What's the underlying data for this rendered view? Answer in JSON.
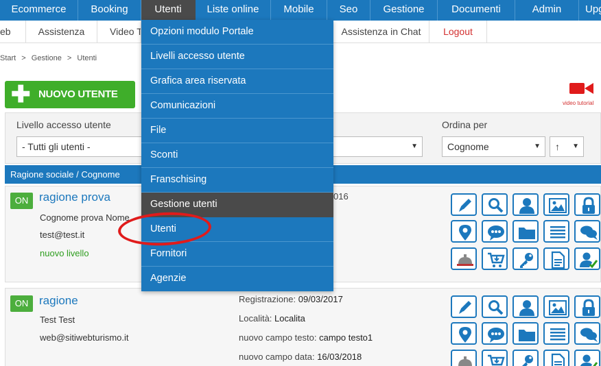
{
  "topnav": [
    "Ecommerce",
    "Booking",
    "Utenti",
    "Liste online",
    "Mobile",
    "Seo",
    "Gestione",
    "Documenti",
    "Admin",
    "Upg"
  ],
  "subnav": [
    "eb",
    "Assistenza",
    "Video T",
    "Assistenza in Chat",
    "Logout"
  ],
  "breadcrumb": [
    "Start",
    ">",
    "Gestione",
    ">",
    "Utenti"
  ],
  "new_user_label": "NUOVO UTENTE",
  "video_label": "video tutorial",
  "filters": {
    "level_label": "Livello accesso utente",
    "level_value": "- Tutti gli utenti -",
    "order_label": "Ordina per",
    "order_value": "Cognome",
    "direction_value": "↑"
  },
  "table_header": "Ragione sociale / Cognome",
  "users": [
    {
      "status": "ON",
      "name": "ragione prova",
      "fullname": "Cognome prova Nome",
      "email": "test@test.it",
      "level": "nuovo livello",
      "registration_partial": "016"
    },
    {
      "status": "ON",
      "name": "ragione",
      "fullname": "Test Test",
      "email": "web@sitiwebturismo.it",
      "registration_label": "Registrazione:",
      "registration_value": "09/03/2017",
      "location_label": "Località:",
      "location_value": "Localita",
      "text_field_label": "nuovo campo testo:",
      "text_field_value": "campo testo1",
      "date_field_label": "nuovo campo data:",
      "date_field_value": "16/03/2018"
    }
  ],
  "action_icons": [
    "edit-icon",
    "search-icon",
    "user-icon",
    "image-icon",
    "lock-icon",
    "map-pin-icon",
    "chat-bubble-icon",
    "folder-icon",
    "list-icon",
    "comments-icon",
    "reception-bell-icon",
    "cart-icon",
    "key-icon",
    "document-icon",
    "user-check-icon"
  ],
  "dropdown": [
    "Opzioni modulo Portale",
    "Livelli accesso utente",
    "Grafica area riservata",
    "Comunicazioni",
    "File",
    "Sconti",
    "Franschising",
    "Gestione utenti",
    "Utenti",
    "Fornitori",
    "Agenzie"
  ],
  "colors": {
    "primary": "#1c78bd",
    "active": "#4a4a4a",
    "green": "#3fae2a",
    "red": "#e01b1b"
  }
}
